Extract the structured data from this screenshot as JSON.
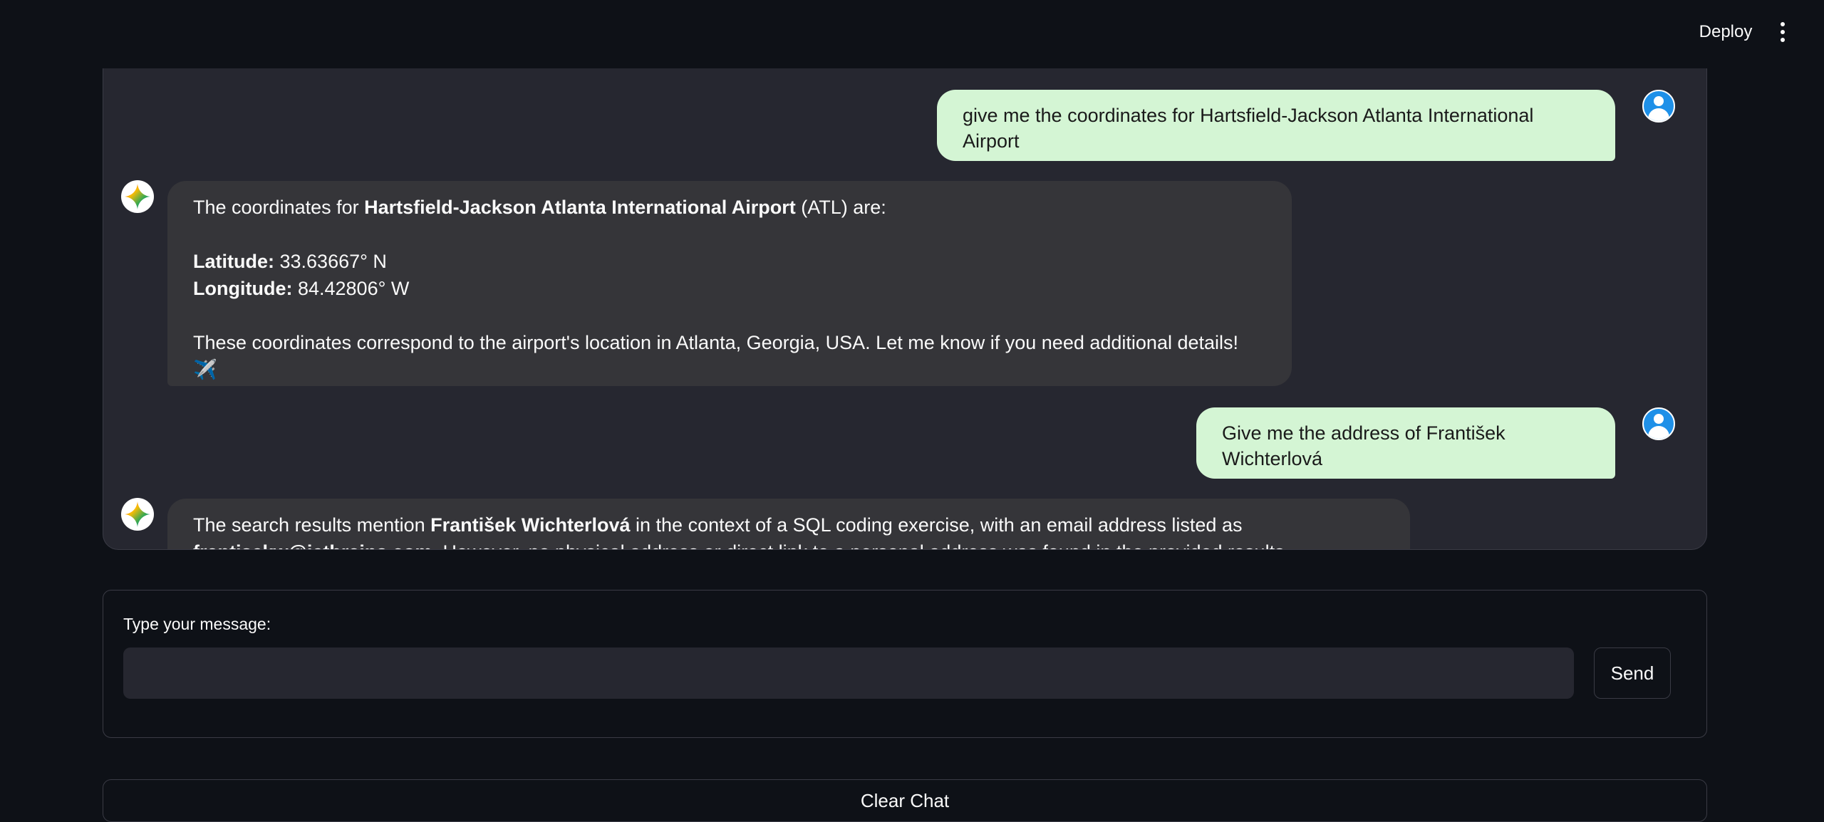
{
  "toolbar": {
    "deploy_label": "Deploy",
    "menu_icon": "more-vertical-icon"
  },
  "chat": {
    "messages": [
      {
        "role": "user",
        "text": "give me the coordinates for Hartsfield-Jackson Atlanta International Airport"
      },
      {
        "role": "assistant",
        "intro_pre": "The coordinates for ",
        "intro_bold": "Hartsfield-Jackson Atlanta International Airport",
        "intro_post": " (ATL) are:",
        "lat_label": "Latitude:",
        "lat_value": " 33.63667° N",
        "lon_label": "Longitude:",
        "lon_value": " 84.42806° W",
        "closing": "These coordinates correspond to the airport's location in Atlanta, Georgia, USA. Let me know if you need additional details! ✈️"
      },
      {
        "role": "user",
        "text": "Give me the address of František Wichterlová"
      },
      {
        "role": "assistant",
        "line1_pre": "The search results mention ",
        "line1_bold": "František Wichterlová",
        "line1_post": " in the context of a SQL coding exercise, with an email address listed as",
        "line2_bold": "frantisekw@jetbrains.com",
        "line2_post": ". However, no physical address or direct link to a personal address was found in the provided results."
      }
    ]
  },
  "form": {
    "label": "Type your message:",
    "input_value": "",
    "send_label": "Send"
  },
  "clear_label": "Clear Chat",
  "colors": {
    "background": "#0e1117",
    "chat_bg": "#262730",
    "user_bubble": "#d4f5d4",
    "assistant_bubble": "#353539",
    "user_avatar": "#1e90e8"
  }
}
